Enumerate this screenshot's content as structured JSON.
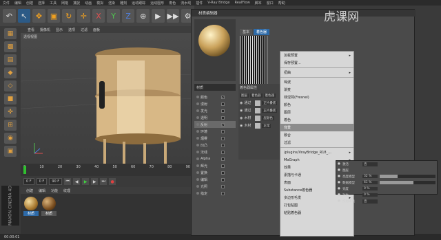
{
  "menubar": [
    "文件",
    "编辑",
    "创建",
    "选择",
    "工具",
    "网格",
    "捕捉",
    "动画",
    "模拟",
    "渲染",
    "雕刻",
    "运动跟踪",
    "运动图形",
    "角色",
    "流水线",
    "插件",
    "V-Ray Bridge",
    "RealFlow",
    "脚本",
    "窗口",
    "帮助"
  ],
  "toolbar": {
    "undo": "↶",
    "select": "↖",
    "move": "✥",
    "scale": "▣",
    "rotate": "↻",
    "live": "✛",
    "x": "X",
    "y": "Y",
    "z": "Z",
    "world": "⊕",
    "render1": "▶",
    "render2": "▶▶",
    "render3": "⚙"
  },
  "viewport": {
    "menu": [
      "查看",
      "摄像机",
      "显示",
      "选项",
      "过滤",
      "面板"
    ],
    "label": "透视视图"
  },
  "timeline": {
    "ticks": [
      "0",
      "10",
      "20",
      "30",
      "40",
      "50",
      "60",
      "70",
      "80",
      "90"
    ],
    "frame_start": "0 F",
    "frame_current": "0 F",
    "frame_end": "90 F"
  },
  "material_manager": {
    "menu": [
      "创建",
      "编辑",
      "功能",
      "纹理"
    ],
    "materials": [
      {
        "label": "材质"
      },
      {
        "label": "材质"
      }
    ]
  },
  "status": "00:00:01",
  "editor": {
    "title": "材质编辑器",
    "material_name": "材质",
    "tabs": [
      "基本",
      "着色器"
    ],
    "channels": [
      {
        "label": "颜色",
        "checked": true
      },
      {
        "label": "漫射",
        "checked": false
      },
      {
        "label": "发光",
        "checked": false
      },
      {
        "label": "透明",
        "checked": false
      },
      {
        "label": "反射",
        "checked": true
      },
      {
        "label": "环境",
        "checked": false
      },
      {
        "label": "烟雾",
        "checked": false
      },
      {
        "label": "凹凸",
        "checked": false
      },
      {
        "label": "法线",
        "checked": false
      },
      {
        "label": "Alpha",
        "checked": false
      },
      {
        "label": "辉光",
        "checked": false
      },
      {
        "label": "置换",
        "checked": false
      },
      {
        "label": "编辑",
        "checked": false
      },
      {
        "label": "光照",
        "checked": false
      },
      {
        "label": "指定",
        "checked": false
      }
    ],
    "layer_header": "着色器属性",
    "layer_buttons": [
      "图层",
      "着色器",
      "着色器"
    ],
    "layers": [
      {
        "name": "通过",
        "mode": "正片叠底"
      },
      {
        "name": "通过",
        "mode": "正片叠底"
      },
      {
        "name": "木材",
        "mode": "层颜色"
      },
      {
        "name": "木材",
        "mode": "正常"
      }
    ]
  },
  "context_menu": {
    "items": [
      {
        "label": "加载预置",
        "sub": true
      },
      {
        "label": "保存预置...",
        "sub": false
      },
      {
        "sep": true
      },
      {
        "label": "扭曲",
        "sub": true
      },
      {
        "sep": true
      },
      {
        "label": "噪波",
        "sub": false
      },
      {
        "label": "渐变",
        "sub": false
      },
      {
        "label": "菲涅耳(Fresnel)",
        "sub": false
      },
      {
        "label": "颜色",
        "sub": false
      },
      {
        "label": "图层",
        "sub": false
      },
      {
        "label": "着色",
        "sub": false
      },
      {
        "label": "背景",
        "sub": false,
        "hl": true
      },
      {
        "label": "融合",
        "sub": false
      },
      {
        "label": "过滤",
        "sub": false
      },
      {
        "sep": true
      },
      {
        "label": "/plugins/VrayBridge_R18_...",
        "sub": true
      },
      {
        "label": "MoGraph",
        "sub": true
      },
      {
        "label": "效果",
        "sub": true
      },
      {
        "label": "素描与卡通",
        "sub": true
      },
      {
        "label": "表面",
        "sub": true
      },
      {
        "label": "Substance着色器",
        "sub": false
      },
      {
        "label": "多边形毛发",
        "sub": true
      },
      {
        "label": "打包贴图",
        "sub": false
      },
      {
        "label": "粘贴着色器",
        "sub": false
      }
    ]
  },
  "submenu": {
    "rows": [
      {
        "label": "激活",
        "value": "否",
        "fill": 0
      },
      {
        "label": "图层",
        "value": "",
        "fill": 0
      },
      {
        "label": "亮度模型",
        "value": "32 %",
        "fill": 0.32
      },
      {
        "label": "数据模型",
        "value": "61 %",
        "fill": 0.61
      },
      {
        "label": "亮度",
        "value": "0 %",
        "fill": 0
      },
      {
        "label": "对比",
        "value": "0 %",
        "fill": 0
      },
      {
        "label": "作为环境",
        "value": "否",
        "fill": 0
      }
    ]
  },
  "watermark": "虎课网"
}
